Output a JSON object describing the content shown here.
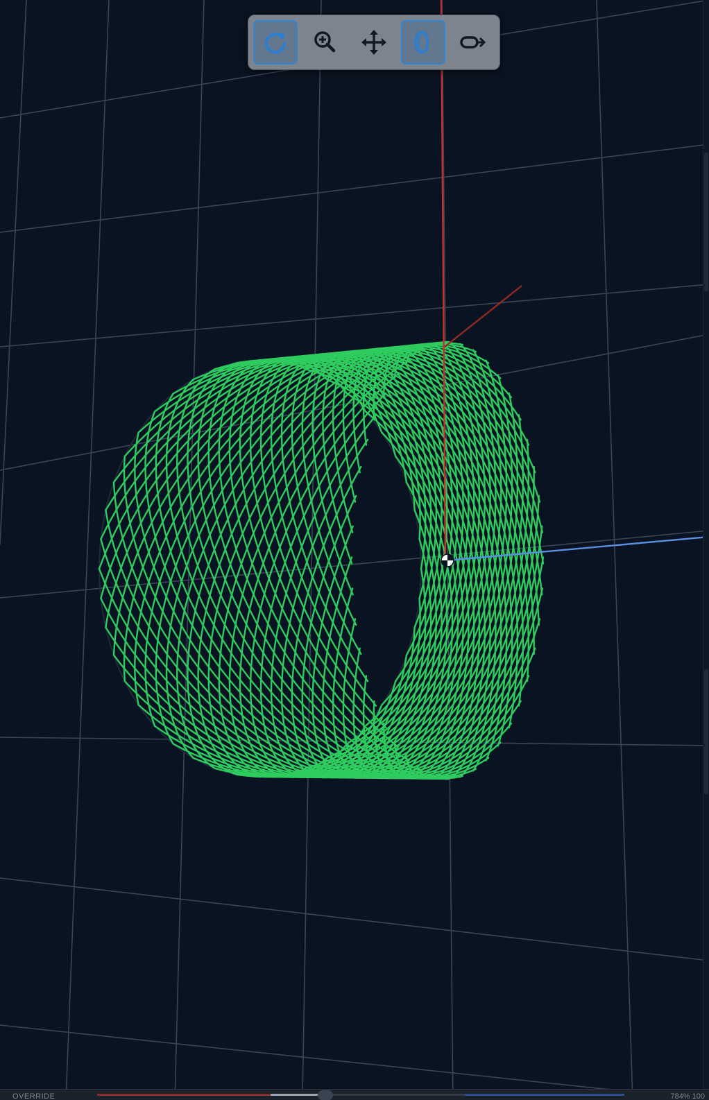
{
  "viewport": {
    "background": "#0a1321",
    "grid_color": "#3b4556",
    "mesh_color": "#2ecc5f",
    "axis_x_color": "#c8302a",
    "axis_y_color": "#8b2a22",
    "axis_z_color": "#5d8fe0",
    "origin_marker": "origin-target-icon"
  },
  "toolbar": {
    "tools": [
      {
        "name": "rotate",
        "icon": "rotate-icon",
        "active": true
      },
      {
        "name": "zoom",
        "icon": "zoom-in-icon",
        "active": false
      },
      {
        "name": "pan",
        "icon": "move-icon",
        "active": false
      },
      {
        "name": "perspective",
        "icon": "perspective-icon",
        "active": true
      },
      {
        "name": "fly",
        "icon": "camera-fly-icon",
        "active": false
      }
    ]
  },
  "statusbar": {
    "label": "OVERRIDE",
    "zoom": "784% 100"
  }
}
